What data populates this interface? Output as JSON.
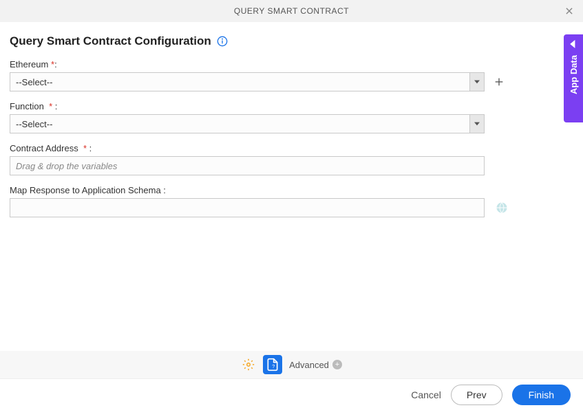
{
  "header": {
    "title": "QUERY SMART CONTRACT"
  },
  "page": {
    "title": "Query Smart Contract Configuration"
  },
  "fields": {
    "ethereum": {
      "label": "Ethereum",
      "value": "--Select--"
    },
    "function": {
      "label": "Function",
      "value": "--Select--"
    },
    "contract_address": {
      "label": "Contract Address",
      "placeholder": "Drag & drop the variables"
    },
    "map_response": {
      "label": "Map Response to Application Schema :"
    }
  },
  "sideTab": {
    "label": "App Data"
  },
  "toolbar": {
    "advanced": "Advanced"
  },
  "footer": {
    "cancel": "Cancel",
    "prev": "Prev",
    "finish": "Finish"
  },
  "colors": {
    "primary": "#1a73e8",
    "accent": "#7b3ff2",
    "warn": "#f5a623"
  }
}
